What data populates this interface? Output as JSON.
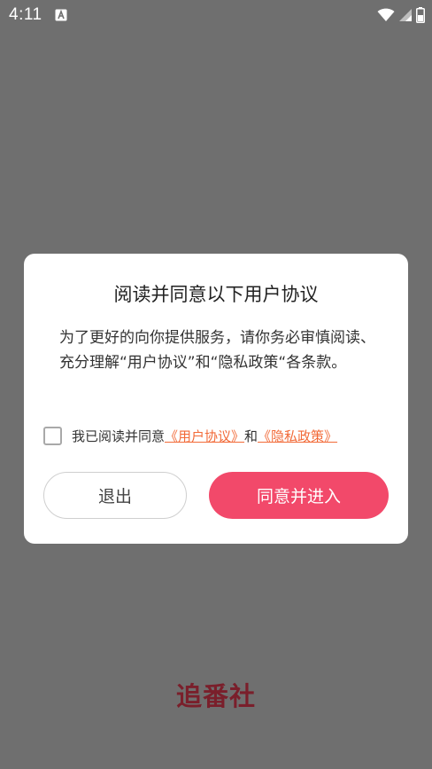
{
  "status_bar": {
    "time": "4:11",
    "icons": [
      "notification-a-icon",
      "wifi-icon",
      "signal-icon",
      "battery-icon"
    ]
  },
  "dialog": {
    "title": "阅读并同意以下用户协议",
    "body": "为了更好的向你提供服务，请你务必审慎阅读、充分理解“用户协议”和“隐私政策“各条款。",
    "agree_prefix": "我已阅读并同意",
    "user_agreement_link": "《用户协议》",
    "and_text": "和",
    "privacy_policy_link": "《隐私政策》",
    "exit_label": "退出",
    "agree_label": "同意并进入"
  },
  "brand": {
    "logo_text": "追番社"
  },
  "colors": {
    "overlay": "#6f6f6f",
    "accent": "#f2496a",
    "link": "#f26a38",
    "brand": "#7a1f2b"
  }
}
